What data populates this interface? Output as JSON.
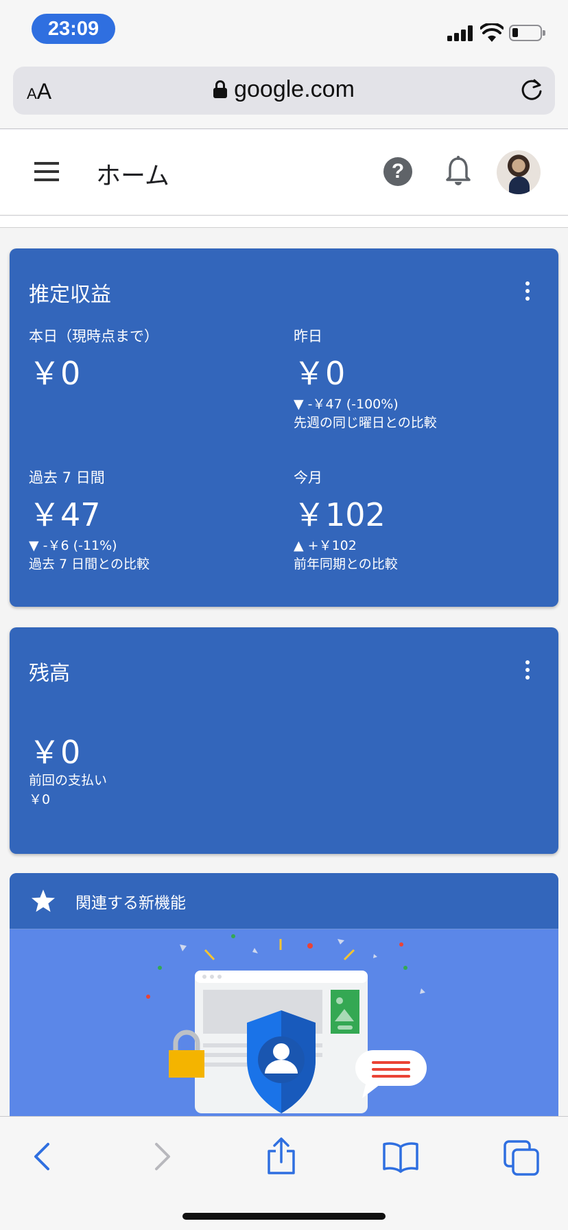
{
  "status_bar": {
    "time": "23:09"
  },
  "browser": {
    "text_size_small": "A",
    "text_size_big": "A",
    "url": "google.com"
  },
  "header": {
    "title": "ホーム"
  },
  "earnings": {
    "title": "推定収益",
    "today": {
      "label": "本日（現時点まで）",
      "value": "￥0"
    },
    "yesterday": {
      "label": "昨日",
      "value": "￥0",
      "change": "▼ -￥47 (-100%)",
      "comparison": "先週の同じ曜日との比較"
    },
    "last7": {
      "label": "過去 7 日間",
      "value": "￥47",
      "change": "▼ -￥6 (-11%)",
      "comparison": "過去 7 日間との比較"
    },
    "this_month": {
      "label": "今月",
      "value": "￥102",
      "change": "▲ +￥102",
      "comparison": "前年同期との比較"
    }
  },
  "balance": {
    "title": "残高",
    "value": "￥0",
    "last_payment_label": "前回の支払い",
    "last_payment_value": "￥0"
  },
  "feature": {
    "title": "関連する新機能"
  },
  "colors": {
    "card_blue": "#3366bb",
    "illustration_blue": "#5b87e8",
    "safari_blue": "#2f6fe0"
  }
}
